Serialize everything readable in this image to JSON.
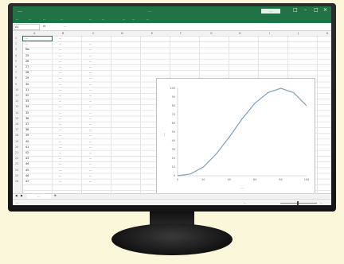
{
  "window": {
    "title": "…",
    "signin_label": "…",
    "quick_access": "…"
  },
  "ribbon_tabs": [
    "…",
    "…",
    "…",
    "…",
    "…",
    "…",
    "…",
    "…",
    "…"
  ],
  "formula_bar": {
    "name_box": "A1",
    "fx": "fx",
    "content": "…"
  },
  "columns": [
    "A",
    "B",
    "C",
    "D",
    "E",
    "F",
    "G",
    "H",
    "I",
    "J",
    "K"
  ],
  "rows": [
    {
      "a": "…",
      "b": "…",
      "c": ""
    },
    {
      "a": "…",
      "b": "…",
      "c": "…"
    },
    {
      "a": "No.",
      "b": "…",
      "c": "…"
    },
    {
      "a": "25",
      "b": "…",
      "c": "…"
    },
    {
      "a": "26",
      "b": "…",
      "c": "…"
    },
    {
      "a": "27",
      "b": "…",
      "c": "…"
    },
    {
      "a": "28",
      "b": "…",
      "c": "…"
    },
    {
      "a": "29",
      "b": "…",
      "c": "…"
    },
    {
      "a": "30",
      "b": "…",
      "c": "…"
    },
    {
      "a": "31",
      "b": "…",
      "c": "…"
    },
    {
      "a": "32",
      "b": "…",
      "c": "…"
    },
    {
      "a": "33",
      "b": "…",
      "c": "…"
    },
    {
      "a": "34",
      "b": "…",
      "c": "…"
    },
    {
      "a": "35",
      "b": "…",
      "c": "…"
    },
    {
      "a": "36",
      "b": "…",
      "c": "…"
    },
    {
      "a": "37",
      "b": "…",
      "c": "…"
    },
    {
      "a": "38",
      "b": "…",
      "c": "…"
    },
    {
      "a": "39",
      "b": "…",
      "c": "…"
    },
    {
      "a": "40",
      "b": "…",
      "c": "…"
    },
    {
      "a": "41",
      "b": "…",
      "c": "…"
    },
    {
      "a": "42",
      "b": "…",
      "c": "…"
    },
    {
      "a": "43",
      "b": "…",
      "c": "…"
    },
    {
      "a": "44",
      "b": "…",
      "c": "…"
    },
    {
      "a": "45",
      "b": "…",
      "c": "…"
    },
    {
      "a": "46",
      "b": "…",
      "c": "…"
    },
    {
      "a": "47",
      "b": "…",
      "c": "…"
    }
  ],
  "sheet_tab": "…",
  "status_left": "…",
  "status_right": "…",
  "zoom": "…",
  "colors": {
    "excel_green": "#217346",
    "curve": "#7f9fbf",
    "desk": "#faf7da"
  },
  "chart_data": {
    "type": "line",
    "title": "",
    "xlabel": "…",
    "ylabel": "…",
    "xlim": [
      0,
      100
    ],
    "ylim": [
      0,
      100
    ],
    "xticks": [
      0,
      20,
      40,
      60,
      80,
      100
    ],
    "yticks": [
      0,
      10,
      20,
      30,
      40,
      50,
      60,
      70,
      80,
      90,
      100
    ],
    "series": [
      {
        "x": [
          0,
          10,
          20,
          30,
          40,
          50,
          60,
          70,
          80,
          90,
          100
        ],
        "y": [
          0,
          2,
          10,
          25,
          44,
          65,
          83,
          95,
          100,
          95,
          80
        ]
      }
    ]
  }
}
